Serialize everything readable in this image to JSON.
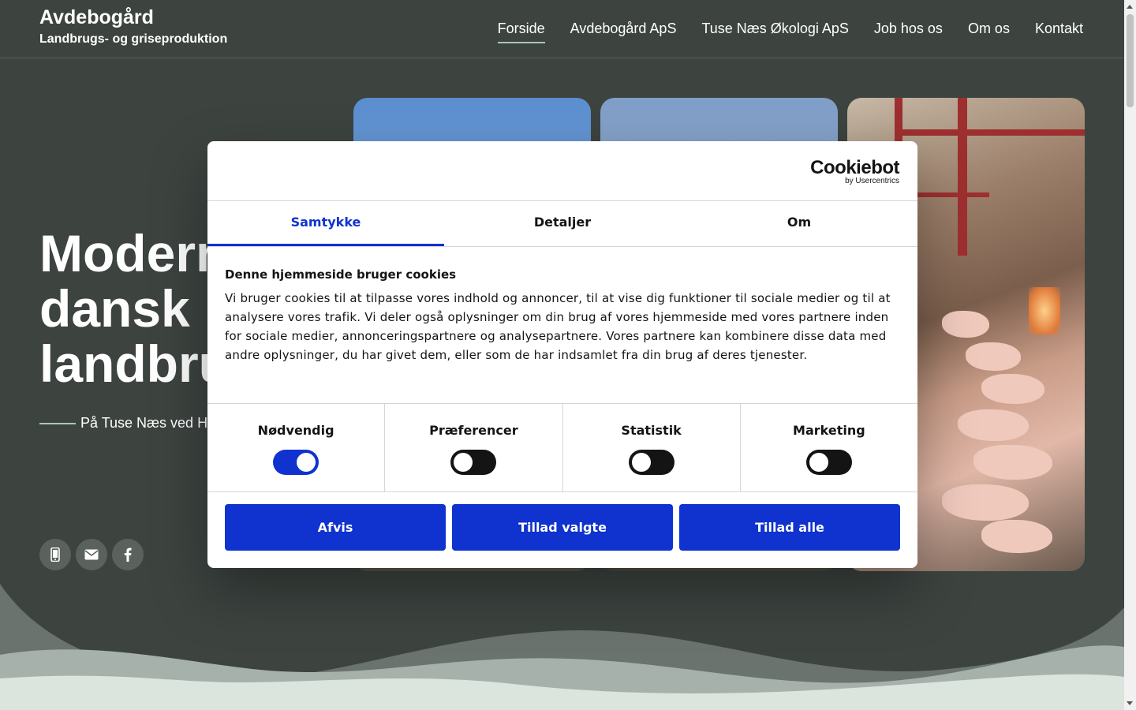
{
  "header": {
    "brand_name": "Avdebogård",
    "brand_sub": "Landbrugs- og griseproduktion",
    "nav": [
      {
        "label": "Forside",
        "active": true
      },
      {
        "label": "Avdebogård ApS"
      },
      {
        "label": "Tuse Næs Økologi ApS"
      },
      {
        "label": "Job hos os"
      },
      {
        "label": "Om os"
      },
      {
        "label": "Kontakt"
      }
    ]
  },
  "hero": {
    "title_line1": "Moderne",
    "title_line2": "dansk",
    "title_line3": "landbrug",
    "subtitle": "På Tuse Næs ved Holbæk",
    "social_icons": [
      "mobile-icon",
      "email-icon",
      "facebook-icon"
    ]
  },
  "cookie": {
    "logo_main": "Cookiebot",
    "logo_sub": "by Usercentrics",
    "tabs": [
      "Samtykke",
      "Detaljer",
      "Om"
    ],
    "heading": "Denne hjemmeside bruger cookies",
    "text": "Vi bruger cookies til at tilpasse vores indhold og annoncer, til at vise dig funktioner til sociale medier og til at analysere vores trafik. Vi deler også oplysninger om din brug af vores hjemmeside med vores partnere inden for sociale medier, annonceringspartnere og analysepartnere. Vores partnere kan kombinere disse data med andre oplysninger, du har givet dem, eller som de har indsamlet fra din brug af deres tjenester.",
    "toggles": [
      {
        "label": "Nødvendig",
        "on": true
      },
      {
        "label": "Præferencer",
        "on": false
      },
      {
        "label": "Statistik",
        "on": false
      },
      {
        "label": "Marketing",
        "on": false
      }
    ],
    "buttons": {
      "reject": "Afvis",
      "allow_selected": "Tillad valgte",
      "allow_all": "Tillad alle"
    }
  },
  "colors": {
    "background": "#3d4440",
    "accent": "#1032cf",
    "nav_underline": "#a9c7b4"
  }
}
